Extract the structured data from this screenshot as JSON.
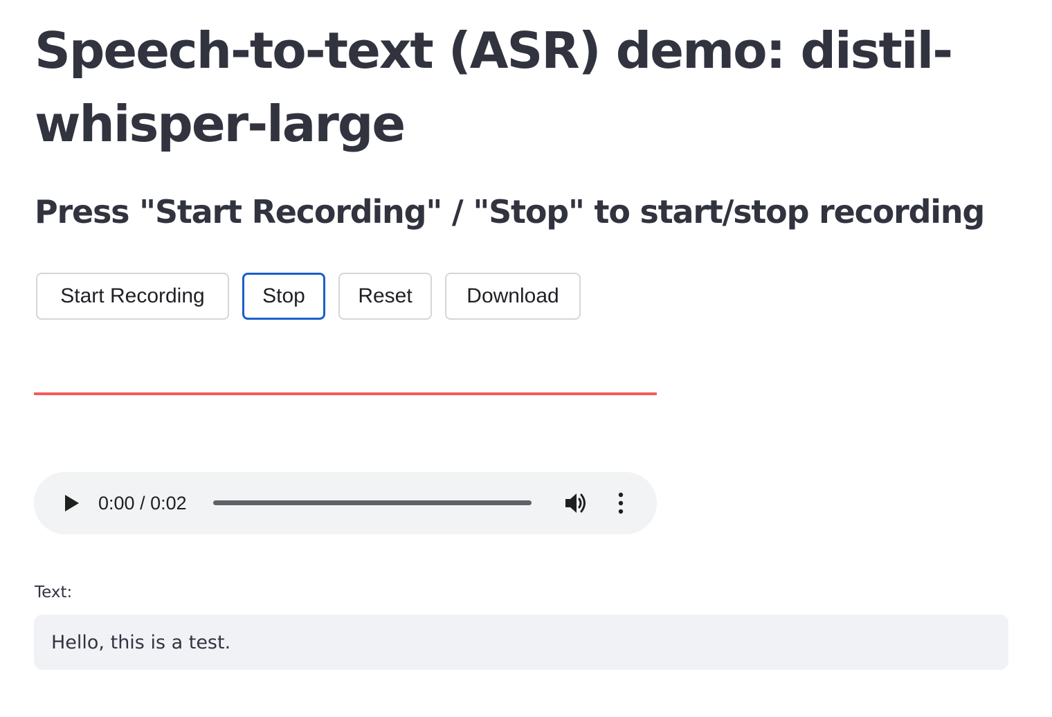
{
  "page": {
    "title": "Speech-to-text (ASR) demo: distil-whisper-large",
    "subtitle": "Press \"Start Recording\" / \"Stop\" to start/stop recording"
  },
  "recorder": {
    "buttons": {
      "start": "Start Recording",
      "stop": "Stop",
      "reset": "Reset",
      "download": "Download"
    },
    "focused_button": "stop",
    "divider_color": "#f25c5c"
  },
  "audio_player": {
    "current_time": "0:00",
    "separator": " / ",
    "duration": "0:02",
    "progress_fraction": 0,
    "icons": {
      "play": "play-icon",
      "volume": "volume-icon",
      "more": "more-vert-icon"
    }
  },
  "transcript": {
    "label": "Text:",
    "value": "Hello, this is a test."
  },
  "colors": {
    "text": "#31333f",
    "focus_border": "#1a5fc9",
    "text_area_bg": "#f0f2f6",
    "player_bg": "#f1f3f4"
  }
}
